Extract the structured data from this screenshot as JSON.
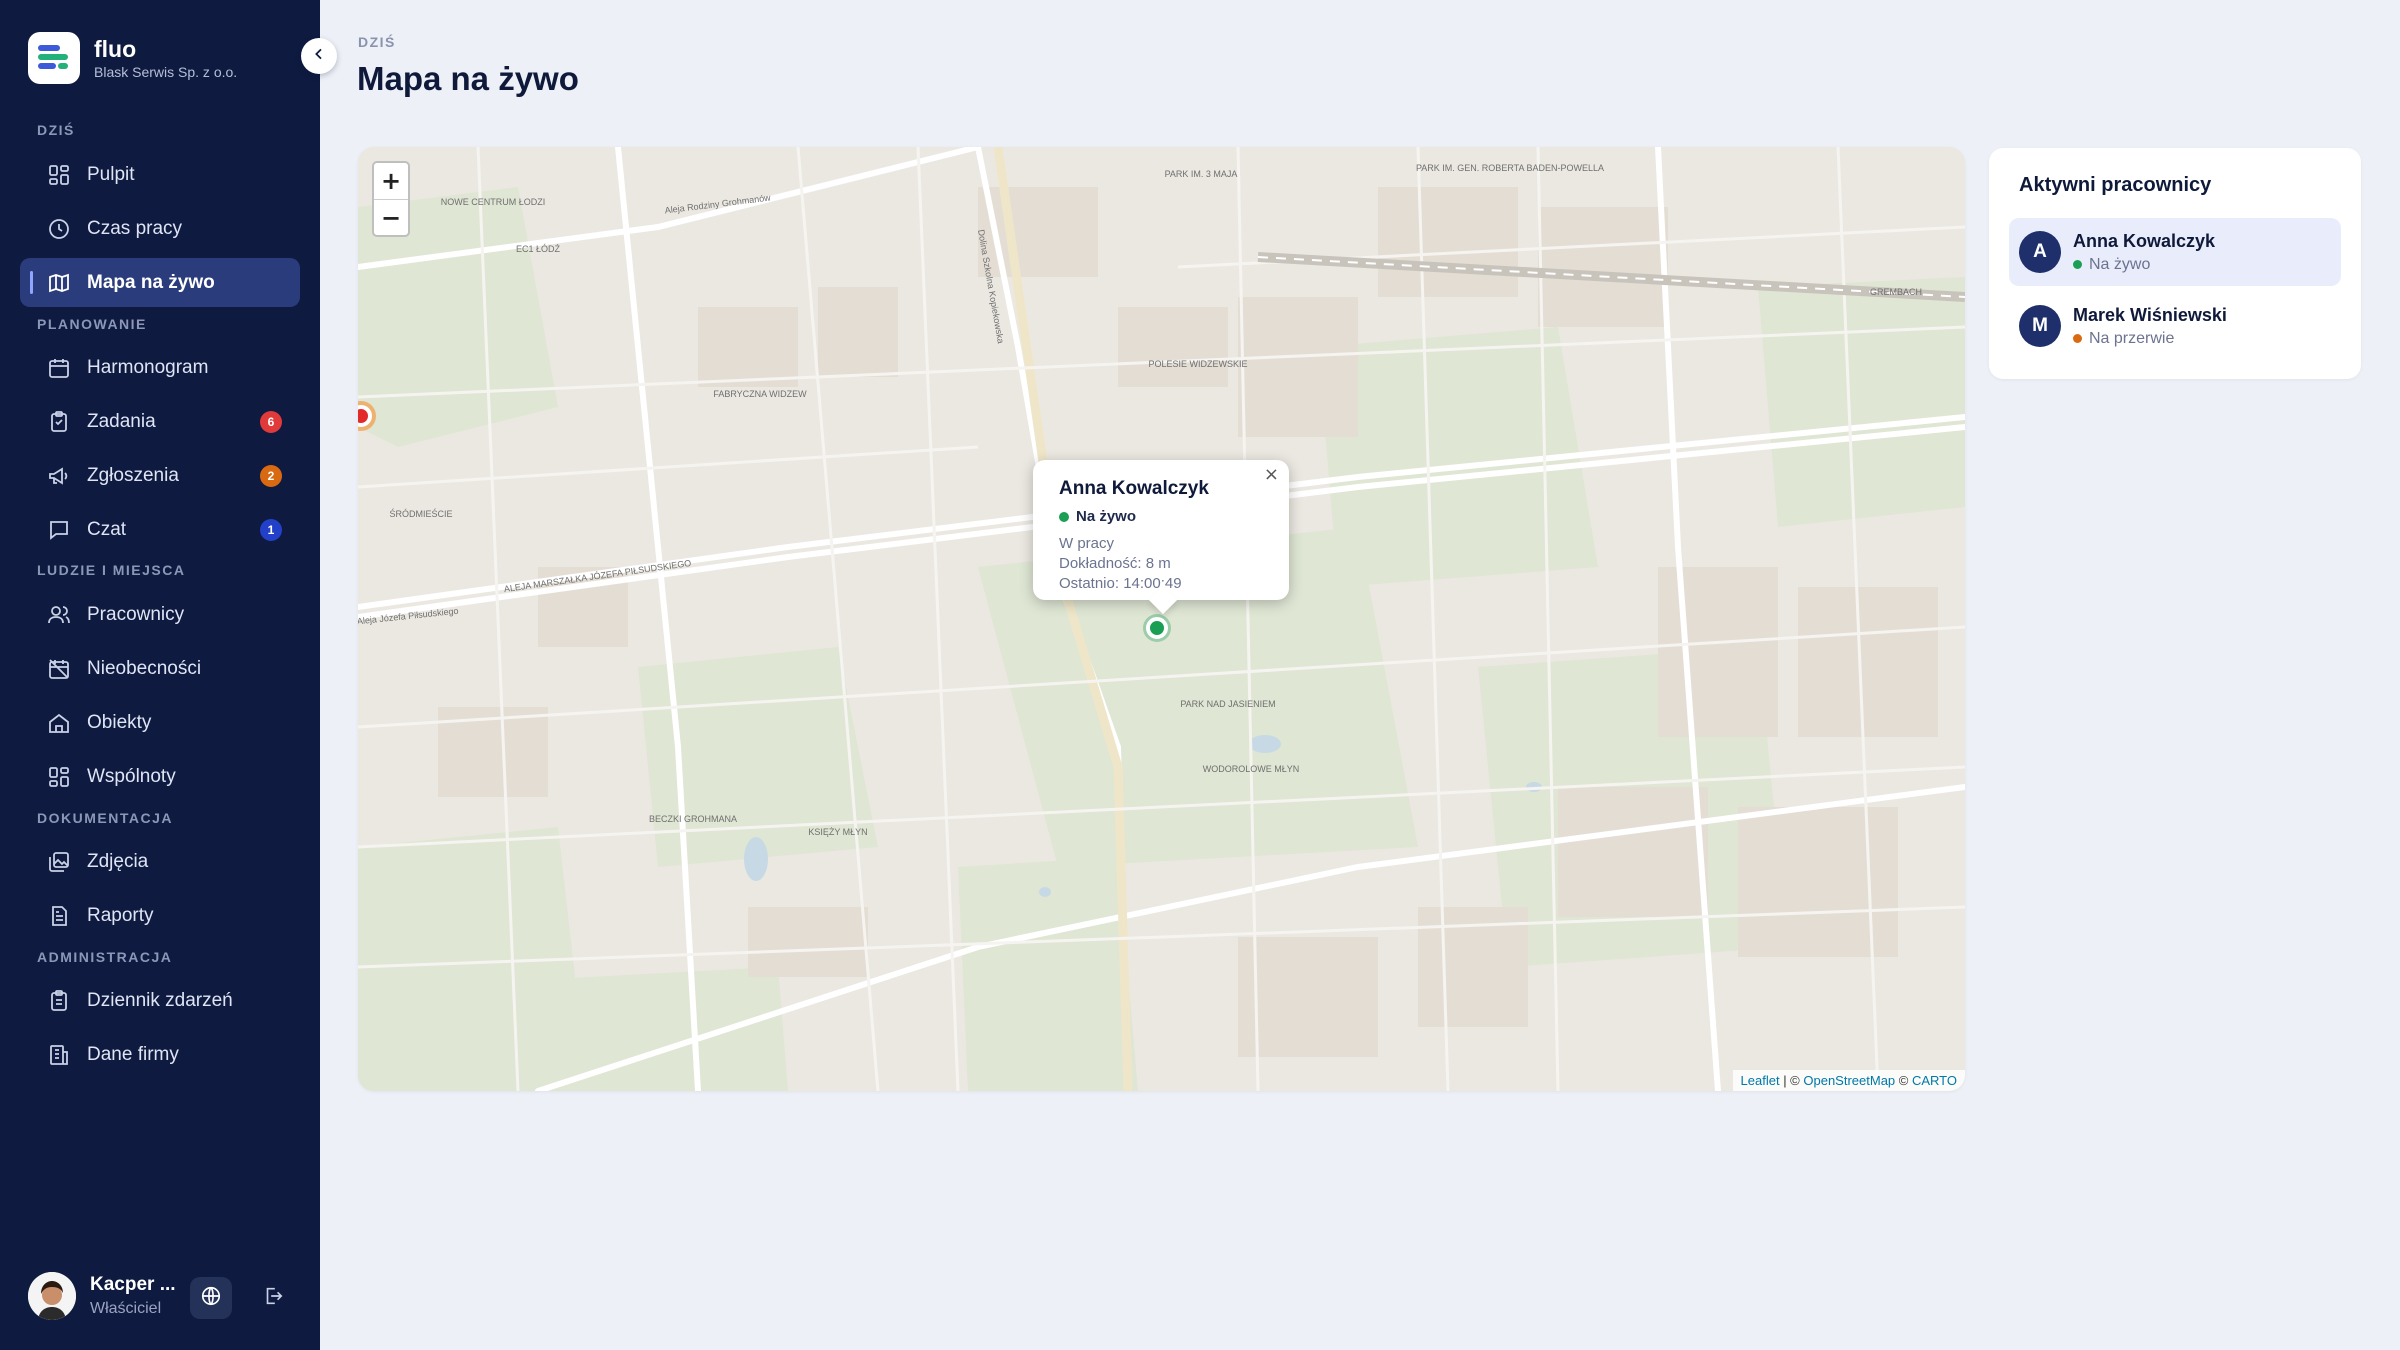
{
  "brand": {
    "name": "fluo",
    "company": "Blask Serwis Sp. z o.o."
  },
  "sidebar": {
    "sections": [
      {
        "label": "DZIŚ"
      },
      {
        "label": "PLANOWANIE"
      },
      {
        "label": "LUDZIE I MIEJSCA"
      },
      {
        "label": "DOKUMENTACJA"
      },
      {
        "label": "ADMINISTRACJA"
      }
    ],
    "items": [
      {
        "label": "Pulpit",
        "icon": "dashboard-icon"
      },
      {
        "label": "Czas pracy",
        "icon": "clock-icon"
      },
      {
        "label": "Mapa na żywo",
        "icon": "map-icon",
        "active": true
      },
      {
        "label": "Harmonogram",
        "icon": "calendar-icon"
      },
      {
        "label": "Zadania",
        "icon": "clipboard-icon",
        "badge": "6",
        "badge_color": "#e03a3a"
      },
      {
        "label": "Zgłoszenia",
        "icon": "megaphone-icon",
        "badge": "2",
        "badge_color": "#d96a12"
      },
      {
        "label": "Czat",
        "icon": "chat-icon",
        "badge": "1",
        "badge_color": "#2340c9"
      },
      {
        "label": "Pracownicy",
        "icon": "users-icon"
      },
      {
        "label": "Nieobecności",
        "icon": "calendar-off-icon"
      },
      {
        "label": "Obiekty",
        "icon": "home-icon"
      },
      {
        "label": "Wspólnoty",
        "icon": "grid-icon"
      },
      {
        "label": "Zdjęcia",
        "icon": "images-icon"
      },
      {
        "label": "Raporty",
        "icon": "report-icon"
      },
      {
        "label": "Dziennik zdarzeń",
        "icon": "clipboard-list-icon"
      },
      {
        "label": "Dane firmy",
        "icon": "building-icon"
      }
    ]
  },
  "user": {
    "name": "Kacper ...",
    "role": "Właściciel"
  },
  "header": {
    "crumb": "DZIŚ",
    "title": "Mapa na żywo"
  },
  "map": {
    "zoom_in": "+",
    "zoom_out": "−",
    "attribution": {
      "leaflet": "Leaflet",
      "sep1": " | © ",
      "osm": "OpenStreetMap",
      "sep2": " © ",
      "carto": "CARTO"
    },
    "labels": [
      "NOWE CENTRUM ŁODZI",
      "EC1 ŁÓDŹ",
      "FABRYCZNA WIDZEW",
      "ŚRÓDMIEŚCIE",
      "POLESIE WIDZEWSKIE",
      "GREMBACH",
      "PARK NAD JASIENIEM",
      "KSIĘŻY MŁYN",
      "ALEJA MARSZAŁKA JÓZEFA PIŁSUDSKIEGO",
      "Aleja Józefa Piłsudskiego",
      "Aleja Rodziny Grohmanów",
      "Dolina Szkolna Kopiekowska",
      "BECZKI GROHMANA",
      "WODOROLOWE MŁYN",
      "PARK IM. 3 MAJA",
      "PARK IM. GEN. ROBERTA BADEN-POWELLA"
    ],
    "popup": {
      "name": "Anna Kowalczyk",
      "status": "Na żywo",
      "status_color": "#1a9f55",
      "state": "W pracy",
      "accuracy": "Dokładność: 8 m",
      "last": "Ostatnio: 14:00:49",
      "close": "×"
    }
  },
  "panel": {
    "title": "Aktywni pracownicy",
    "workers": [
      {
        "initial": "A",
        "name": "Anna Kowalczyk",
        "status": "Na żywo",
        "status_color": "#1a9f55"
      },
      {
        "initial": "M",
        "name": "Marek Wiśniewski",
        "status": "Na przerwie",
        "status_color": "#d96a12"
      }
    ]
  }
}
